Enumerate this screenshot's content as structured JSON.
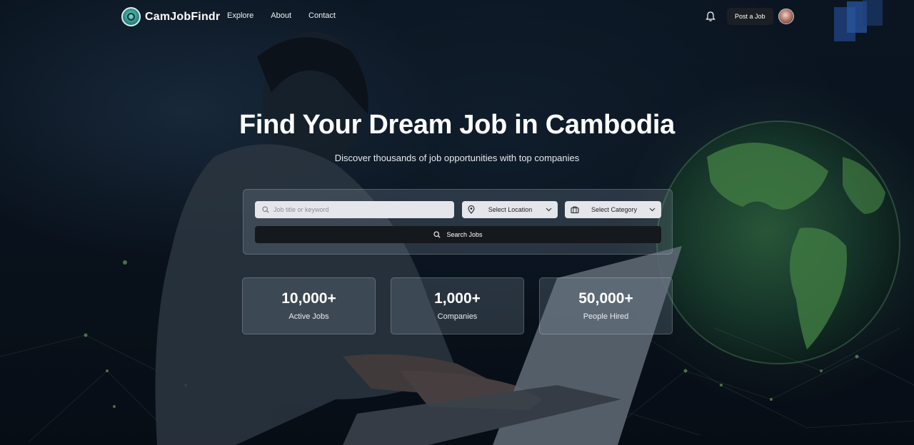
{
  "brand": {
    "name": "CamJobFindr"
  },
  "nav": {
    "links": [
      "Explore",
      "About",
      "Contact"
    ],
    "post_job_label": "Post a Job",
    "icons": [
      "bell-icon",
      "avatar"
    ]
  },
  "hero": {
    "title": "Find Your Dream Job in Cambodia",
    "subtitle": "Discover thousands of job opportunities with top companies"
  },
  "search": {
    "keyword_placeholder": "Job title or keyword",
    "location_label": "Select Location",
    "category_label": "Select Category",
    "button_label": "Search Jobs"
  },
  "stats": [
    {
      "value": "10,000+",
      "label": "Active Jobs"
    },
    {
      "value": "1,000+",
      "label": "Companies"
    },
    {
      "value": "50,000+",
      "label": "People Hired"
    }
  ],
  "colors": {
    "background": "#0b1420",
    "panel": "rgba(120,135,150,0.28)",
    "button_dark": "#15181d",
    "globe_green": "#4caf50"
  }
}
